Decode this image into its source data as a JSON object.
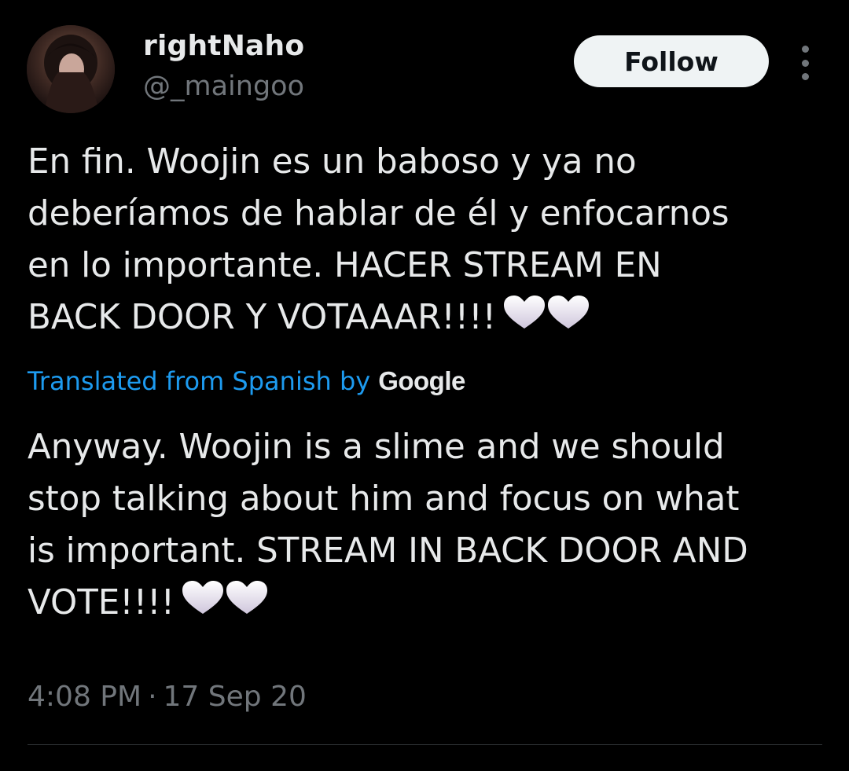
{
  "author": {
    "display_name": "rightNaho",
    "handle": "@_maingoo"
  },
  "follow_label": "Follow",
  "tweet": {
    "original_lines": [
      "En fin. Woojin es un baboso y ya no",
      "deberíamos de hablar de él y enfocarnos",
      "en lo importante. HACER STREAM EN",
      "BACK DOOR Y VOTAAAR!!!!"
    ],
    "translated_label": "Translated from Spanish by",
    "translator": "Google",
    "translation_lines": [
      "Anyway. Woojin is a slime and we should",
      "stop talking about him and focus on what",
      "is important. STREAM IN BACK DOOR AND",
      "VOTE!!!!"
    ],
    "emoji": [
      "white-heart",
      "white-heart"
    ]
  },
  "meta": {
    "time": "4:08 PM",
    "separator": "·",
    "date": "17 Sep 20"
  },
  "colors": {
    "background": "#000000",
    "text": "#e7e9ea",
    "muted": "#71767b",
    "link": "#1d9bf0",
    "button_bg": "#eff3f4"
  }
}
